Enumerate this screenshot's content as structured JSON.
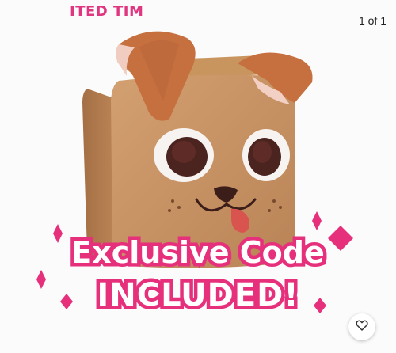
{
  "banner_text": "ITED TIM",
  "image_counter": "1 of 1",
  "slogan": {
    "line1": "Exclusive Code",
    "line2": "INCLUDED!"
  },
  "favorite": {
    "icon": "heart-outline-icon"
  },
  "colors": {
    "accent_pink": "#e6307c",
    "plush_tan": "#c88f62",
    "ear_brown": "#c9744a"
  }
}
